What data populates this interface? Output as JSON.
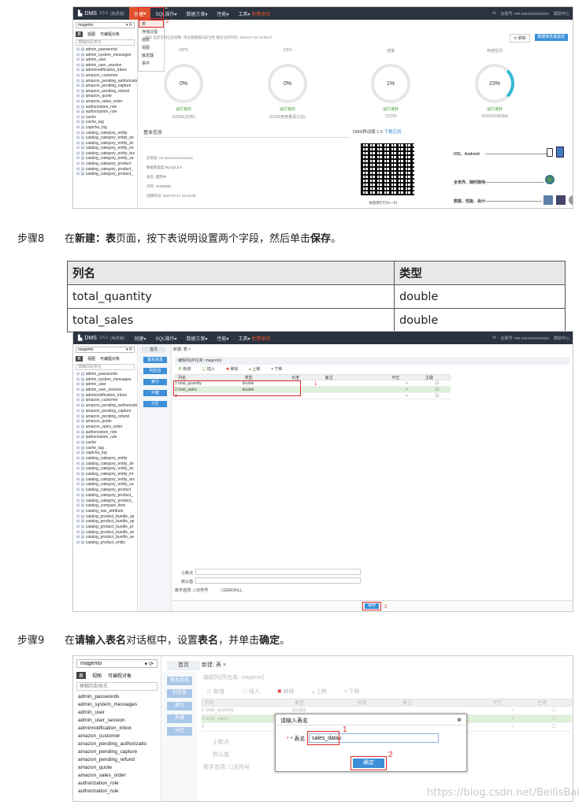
{
  "shot1": {
    "brand": "DMS",
    "version": "3.5.2",
    "edition": "(免费版)",
    "menus": [
      "创建",
      "SQL操作",
      "数据方案",
      "性能",
      "工具"
    ],
    "menu_arrow": "▾",
    "create_badge": "1",
    "tools_badge": "免费体验",
    "dropdown_items": [
      "表",
      "存储过程",
      "函数",
      "视图",
      "触发器",
      "事件"
    ],
    "dropdown_badge": "2",
    "user_text": "云账号: mn-xxxxxxxxxxxxxx",
    "help_text": "帮助中心",
    "db_select": "magento",
    "panel_tabs": [
      "表",
      "视图",
      "可编程对象"
    ],
    "search_placeholder": "模糊匹配表名",
    "tables": [
      "admin_passwords",
      "admin_system_messages",
      "admin_user",
      "admin_user_session",
      "adminnotification_inbox",
      "amazon_customer",
      "amazon_pending_authorizatio",
      "amazon_pending_capture",
      "amazon_pending_refund",
      "amazon_quote",
      "amazon_sales_order",
      "authorization_role",
      "authorization_rule",
      "cache",
      "cache_tag",
      "captcha_log",
      "catalog_category_entity",
      "catalog_category_entity_de",
      "catalog_category_entity_dc",
      "catalog_category_entity_int",
      "catalog_category_entity_tex",
      "catalog_category_entity_va",
      "catalog_category_product",
      "catalog_category_product_",
      "catalog_category_product_"
    ],
    "info_line": "首页   当前实例已连接数:    请注意数据的安全性  最近访问时间: 2019-07-15 14:36:27",
    "refresh_button": "⟳ 刷新",
    "upgrade_button": "数据库性能监控",
    "gauges": [
      {
        "title": "IOPS",
        "value": "0%",
        "status": "运行良好",
        "detail": "3/2000(次/秒)"
      },
      {
        "title": "CPU",
        "value": "0%",
        "status": "运行良好",
        "detail": "0/100(使用量百分比)"
      },
      {
        "title": "连接",
        "value": "1%",
        "status": "运行良好",
        "detail": "7/1200"
      },
      {
        "title": "存储空间",
        "value": "23%",
        "status": "运行良好",
        "detail": "2310/10240(M)"
      }
    ],
    "basic_info_title": "基本信息",
    "basic_info": [
      "实例名: rm-xxxxxxxxxxxxxxxx",
      "数据库类型:MySQL5.6",
      "状态: 使用中",
      "内存: 2048(MB)",
      "创建时间: 2019-07-17 16:40:08"
    ],
    "mobile_title": "DMS移动版 1.0",
    "mobile_link": "下载应用",
    "mobile_features": [
      "iOS、Android",
      "全世界、随时随地",
      "数据、性能、会计"
    ],
    "qr_caption": "请使用钉钉扫一扫"
  },
  "step8": {
    "num": "步骤8",
    "pre": "在",
    "b1": "新建：表",
    "mid": "页面，按下表说明设置两个字段，然后单击",
    "b2": "保存",
    "end": "。"
  },
  "spec_table": {
    "headers": [
      "列名",
      "类型"
    ],
    "rows": [
      [
        "total_quantity",
        "double"
      ],
      [
        "total_sales",
        "double"
      ]
    ]
  },
  "shot2": {
    "menus": [
      "创建",
      "SQL操作",
      "数据方案",
      "性能",
      "工具"
    ],
    "home_tab": "首页",
    "tab": "新建: 表",
    "tab_close": "×",
    "side_buttons": [
      "基本信息",
      "列信息",
      "索引",
      "外键",
      "分区"
    ],
    "table_location": "编辑列(存在库: magento)",
    "toolbar": [
      "新增",
      "插入",
      "移除",
      "上移",
      "下移"
    ],
    "columns": [
      "列名",
      "类型",
      "长度",
      "备注",
      "可空",
      "主键"
    ],
    "rows": [
      {
        "idx": "1",
        "name": "total_quantity",
        "type": "double",
        "nullable": "✓"
      },
      {
        "idx": "2",
        "name": "total_sales",
        "type": "double",
        "nullable": "✓"
      },
      {
        "idx": "3",
        "name": "",
        "type": "",
        "nullable": "✓"
      }
    ],
    "badge_a": "1",
    "decimals_label": "小数点",
    "default_label": "默认值",
    "options_label": "数字选项:",
    "unsigned": "无符号",
    "zerofill": "ZEROFILL",
    "save_button": "保存",
    "save_badge": "2",
    "extra_tables": [
      "catalog_compare_item",
      "catalog_eav_attribute",
      "catalog_product_bundle_op",
      "catalog_product_bundle_op",
      "catalog_product_bundle_pr",
      "catalog_product_bundle_se",
      "catalog_product_bundle_se",
      "catalog_product_entity"
    ]
  },
  "step9": {
    "num": "步骤9",
    "pre": "在",
    "b1": "请输入表名",
    "mid": "对话框中，设置",
    "b2": "表名",
    "mid2": "，并单击",
    "b3": "确定",
    "end": "。"
  },
  "shot3": {
    "db_select": "magento",
    "search_placeholder": "模糊匹配表名",
    "panel_tabs": [
      "表",
      "视图",
      "可编程对象"
    ],
    "tables": [
      "admin_passwords",
      "admin_system_messages",
      "admin_user",
      "admin_user_session",
      "adminnotification_inbox",
      "amazon_customer",
      "amazon_pending_authorizatio",
      "amazon_pending_capture",
      "amazon_pending_refund",
      "amazon_quote",
      "amazon_sales_order",
      "authorization_role",
      "authorization_rule"
    ],
    "home_tab": "首页",
    "tab": "新建: 表",
    "table_location": "编辑列(所在库: magento)",
    "dialog_title": "请输入表名",
    "dialog_label": "* 表名",
    "dialog_value": "sales_datav",
    "dialog_badge1": "1",
    "dialog_badge2": "2",
    "ok_button": "确定",
    "close_icon": "⊗"
  },
  "watermark": "https://blog.csdn.net/BeilisBai"
}
